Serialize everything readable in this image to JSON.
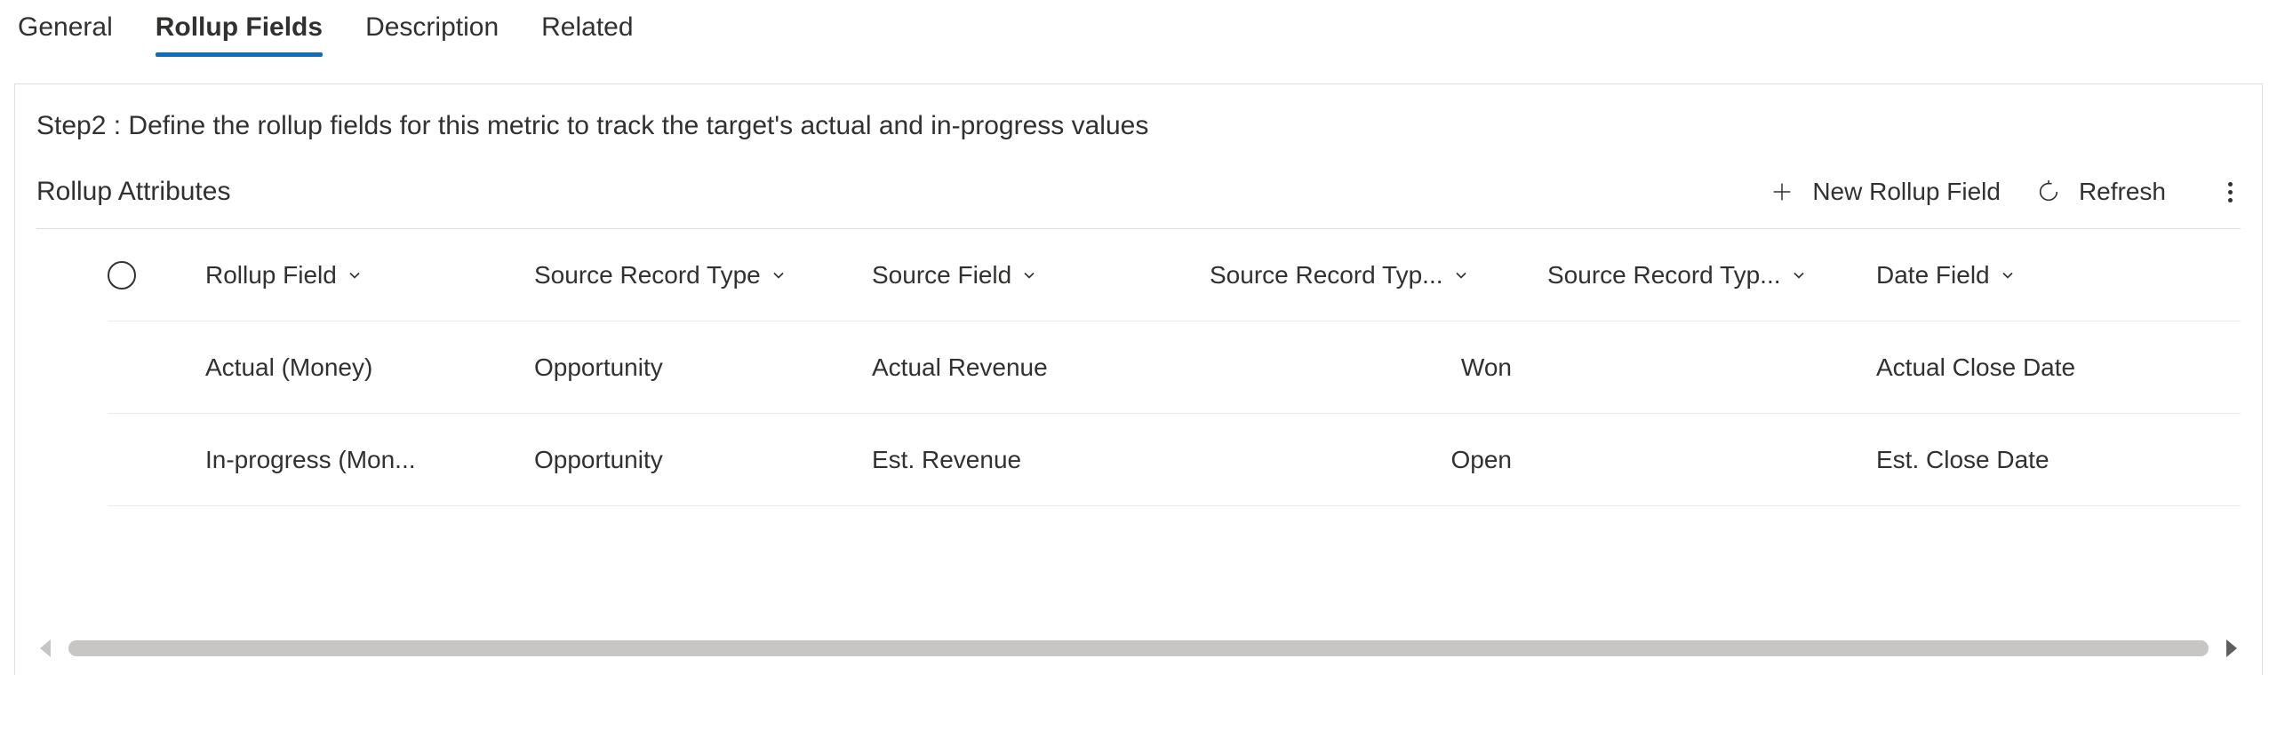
{
  "tabs": {
    "general": "General",
    "rollup_fields": "Rollup Fields",
    "description": "Description",
    "related": "Related",
    "active": "rollup_fields"
  },
  "step_title": "Step2 : Define the rollup fields for this metric to track the target's actual and in-progress values",
  "grid": {
    "title": "Rollup Attributes",
    "actions": {
      "new": "New Rollup Field",
      "refresh": "Refresh"
    },
    "columns": {
      "rollup_field": "Rollup Field",
      "source_record_type": "Source Record Type",
      "source_field": "Source Field",
      "source_record_typ_1": "Source Record Typ...",
      "source_record_typ_2": "Source Record Typ...",
      "date_field": "Date Field"
    },
    "rows": [
      {
        "rollup_field": "Actual (Money)",
        "source_record_type": "Opportunity",
        "source_field": "Actual Revenue",
        "source_record_typ_1": "Won",
        "source_record_typ_2": "",
        "date_field": "Actual Close Date"
      },
      {
        "rollup_field": "In-progress (Mon...",
        "source_record_type": "Opportunity",
        "source_field": "Est. Revenue",
        "source_record_typ_1": "Open",
        "source_record_typ_2": "",
        "date_field": "Est. Close Date"
      }
    ]
  }
}
